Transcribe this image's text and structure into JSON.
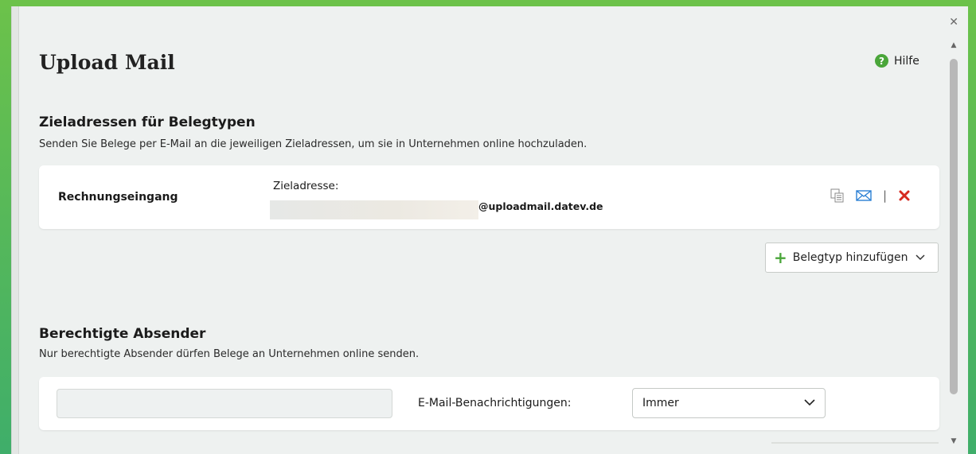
{
  "window": {
    "close_icon": "close-icon"
  },
  "header": {
    "title": "Upload Mail",
    "help_label": "Hilfe",
    "help_icon_glyph": "?"
  },
  "section_targets": {
    "title": "Zieladressen für Belegtypen",
    "description": "Senden Sie Belege per E-Mail an die jeweiligen Zieladressen, um sie in Unternehmen online hochzuladen.",
    "rows": [
      {
        "label": "Rechnungseingang",
        "address_label": "Zieladresse:",
        "address_domain": "@uploadmail.datev.de",
        "actions": [
          "copy-icon",
          "mail-icon",
          "delete-icon"
        ]
      }
    ],
    "add_button": {
      "label": "Belegtyp hinzufügen"
    }
  },
  "section_senders": {
    "title": "Berechtigte Absender",
    "description": "Nur berechtigte Absender dürfen Belege an Unternehmen online senden.",
    "sender_input_value": "",
    "notifications_label": "E-Mail-Benachrichtigungen:",
    "notifications_value": "Immer"
  },
  "colors": {
    "accent_green": "#4aa63a",
    "mail_blue": "#2a7fd4",
    "delete_red": "#d62a1f"
  }
}
